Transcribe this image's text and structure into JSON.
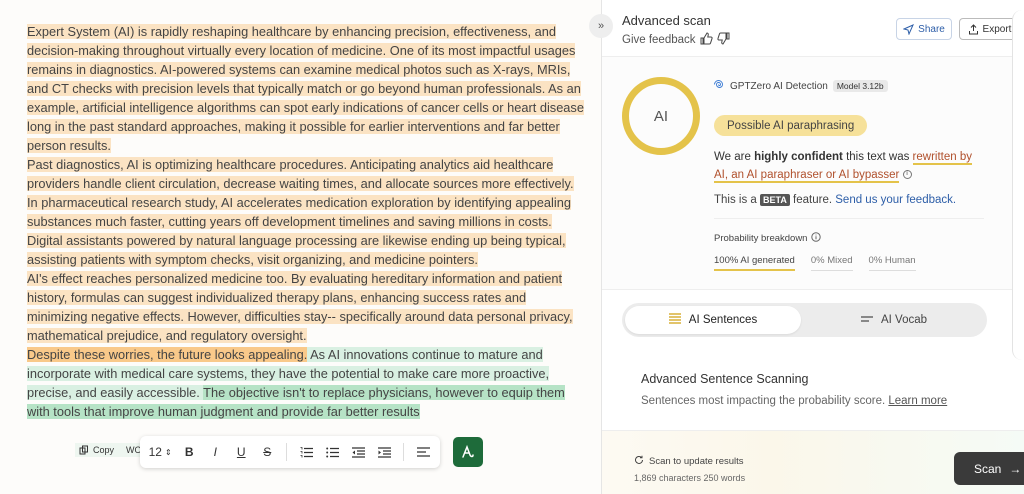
{
  "editor": {
    "p1": [
      {
        "t": "Expert System (AI) is rapidly reshaping healthcare by enhancing precision, effectiveness, and decision-making throughout virtually every location of medicine. One of its most impactful usages remains in diagnostics. AI-powered systems can examine medical photos such as X-rays, MRIs, and CT checks with precision levels that typically match or go beyond human professionals. As an example, artificial intelligence algorithms can spot early indications of cancer cells or heart disease long in the past standard approaches, making it possible for earlier interventions and far better person results."
      }
    ],
    "p2": "Past diagnostics, AI is optimizing healthcare procedures. Anticipating analytics aid healthcare providers handle client circulation, decrease waiting times, and allocate sources more effectively. In pharmaceutical research study, AI accelerates medication exploration by identifying appealing substances much faster, cutting years off development timelines and saving millions in costs. Digital assistants powered by natural language processing are likewise ending up being typical, assisting patients with symptom checks, visit organizing, and medicine pointers.",
    "p3": "AI's effect reaches personalized medicine too. By evaluating hereditary information and patient history, formulas can suggest individualized therapy plans, enhancing success rates and minimizing negative effects. However, difficulties stay-- specifically around data personal privacy, mathematical prejudice, and regulatory oversight.",
    "p4_strong": "Despite these worries, the future looks appealing.",
    "p4_green": " As AI innovations continue to mature and incorporate with medical care systems, they have the potential to make care more proactive, precise, and easily accessible. ",
    "p4_green_strong": "The objective isn't to replace physicians, however to equip them with tools that improve human judgment and provide far better results",
    "copy_label": "Copy",
    "copy_extra": "WO",
    "toolbar": {
      "font_size": "12",
      "bold": "B",
      "italic": "I",
      "underline": "U",
      "strike": "S"
    }
  },
  "panel": {
    "title": "Advanced scan",
    "feedback": "Give feedback",
    "share": "Share",
    "export": "Export",
    "ring_label": "AI",
    "detector": "GPTZero AI Detection",
    "model": "Model 3.12b",
    "verdict": "Possible AI paraphrasing",
    "conf_pre": "We are ",
    "conf_bold": "highly confident",
    "conf_mid": " this text was ",
    "conf_ul": "rewritten by AI, an AI paraphraser or AI bypasser",
    "beta_pre": "This is a ",
    "beta": "BETA",
    "beta_mid": " feature. ",
    "beta_link": "Send us your feedback.",
    "prob_title": "Probability breakdown",
    "prob_ai": "100% AI generated",
    "prob_mixed": "0% Mixed",
    "prob_human": "0% Human",
    "tab_sentences": "AI Sentences",
    "tab_vocab": "AI Vocab",
    "adv_title": "Advanced Sentence Scanning",
    "adv_desc": "Sentences most impacting the probability score. ",
    "adv_link": "Learn more",
    "scan_update": "Scan to update results",
    "counts": "1,869 characters 250 words",
    "scan": "Scan"
  },
  "colors": {
    "highlight_orange": "#fbe3c3",
    "highlight_orange_strong": "#f9c98a",
    "highlight_green": "#d9f0e2",
    "ring": "#e4c34a",
    "link": "#2d5ea8"
  }
}
